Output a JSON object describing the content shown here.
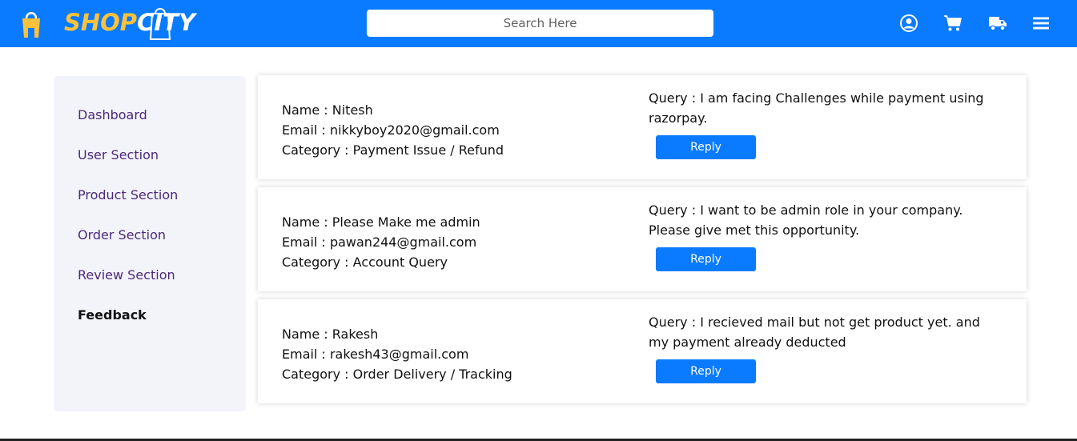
{
  "header": {
    "logo_shop": "SHOP",
    "logo_city": "CITY",
    "search_placeholder": "Search Here",
    "icons": [
      "user-circle-icon",
      "cart-icon",
      "truck-icon",
      "menu-icon"
    ],
    "bg_color": "#0a7bff",
    "logo_accent": "#ffc13b"
  },
  "sidebar": {
    "items": [
      {
        "label": "Dashboard"
      },
      {
        "label": "User Section"
      },
      {
        "label": "Product Section"
      },
      {
        "label": "Order Section"
      },
      {
        "label": "Review Section"
      },
      {
        "label": "Feedback"
      }
    ],
    "active": "Feedback"
  },
  "feedback": [
    {
      "name": "Name : Nitesh",
      "email": "Email : nikkyboy2020@gmail.com",
      "category": "Category : Payment Issue / Refund",
      "query": "Query : I am facing Challenges while payment using razorpay.",
      "reply_label": "Reply"
    },
    {
      "name": "Name : Please Make me admin",
      "email": "Email : pawan244@gmail.com",
      "category": "Category : Account Query",
      "query": "Query : I want to be admin role in your company. Please give met this opportunity.",
      "reply_label": "Reply"
    },
    {
      "name": "Name : Rakesh",
      "email": "Email : rakesh43@gmail.com",
      "category": "Category : Order Delivery / Tracking",
      "query": "Query : I recieved mail but not get product yet. and my payment already deducted",
      "reply_label": "Reply"
    }
  ]
}
